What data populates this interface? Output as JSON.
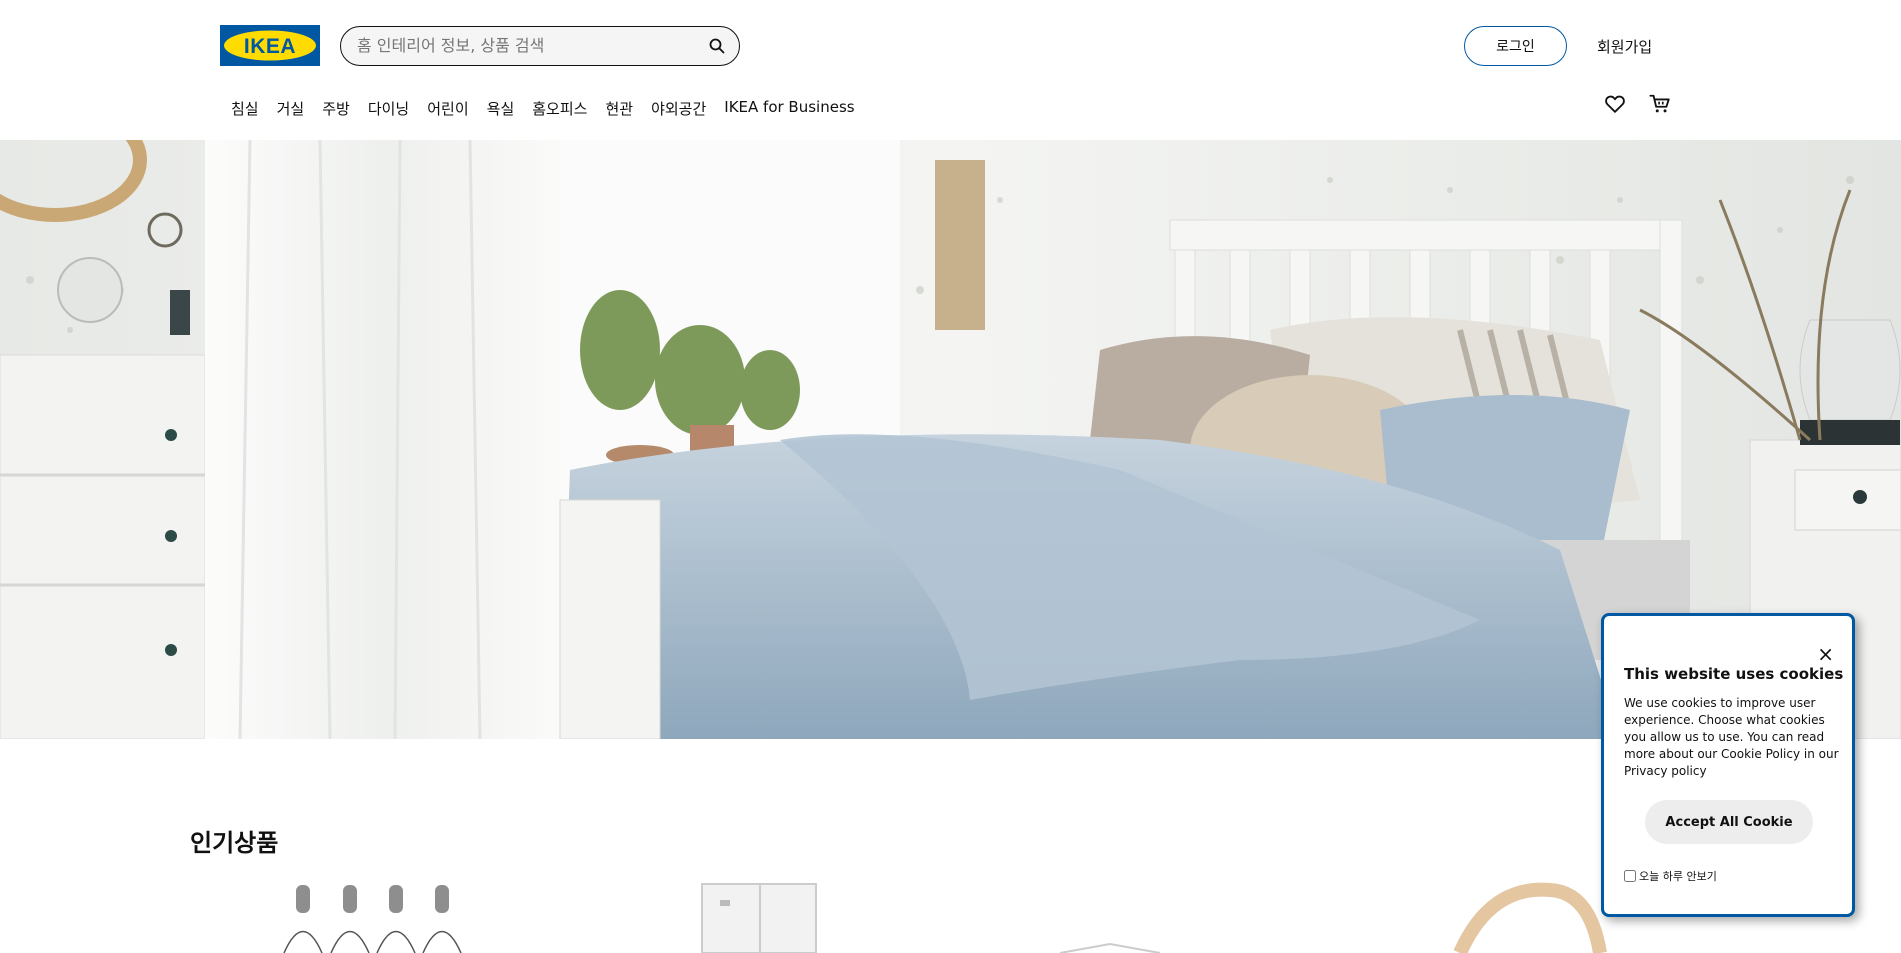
{
  "header": {
    "logo_text": "IKEA",
    "search_placeholder": "홈 인테리어 정보, 상품 검색",
    "login_label": "로그인",
    "signup_label": "회원가입"
  },
  "nav": {
    "items": [
      "침실",
      "거실",
      "주방",
      "다이닝",
      "어린이",
      "욕실",
      "홈오피스",
      "현관",
      "야외공간",
      "IKEA for Business"
    ]
  },
  "icons": {
    "search": "search-icon",
    "wishlist": "heart-icon",
    "cart": "cart-icon"
  },
  "carousel": {
    "active_index": 1,
    "count": 2
  },
  "section": {
    "title": "인기상품"
  },
  "cookie": {
    "title": "This website uses cookies",
    "body": "We use cookies to improve user experience. Choose what cookies you allow us to use. You can read more about our Cookie Policy in our Privacy policy",
    "accept_label": "Accept All Cookie",
    "dismiss_label": "오늘 하루 안보기",
    "close_symbol": "×"
  },
  "colors": {
    "brand_blue": "#0058a3",
    "brand_yellow": "#ffdb00",
    "text": "#111111"
  }
}
